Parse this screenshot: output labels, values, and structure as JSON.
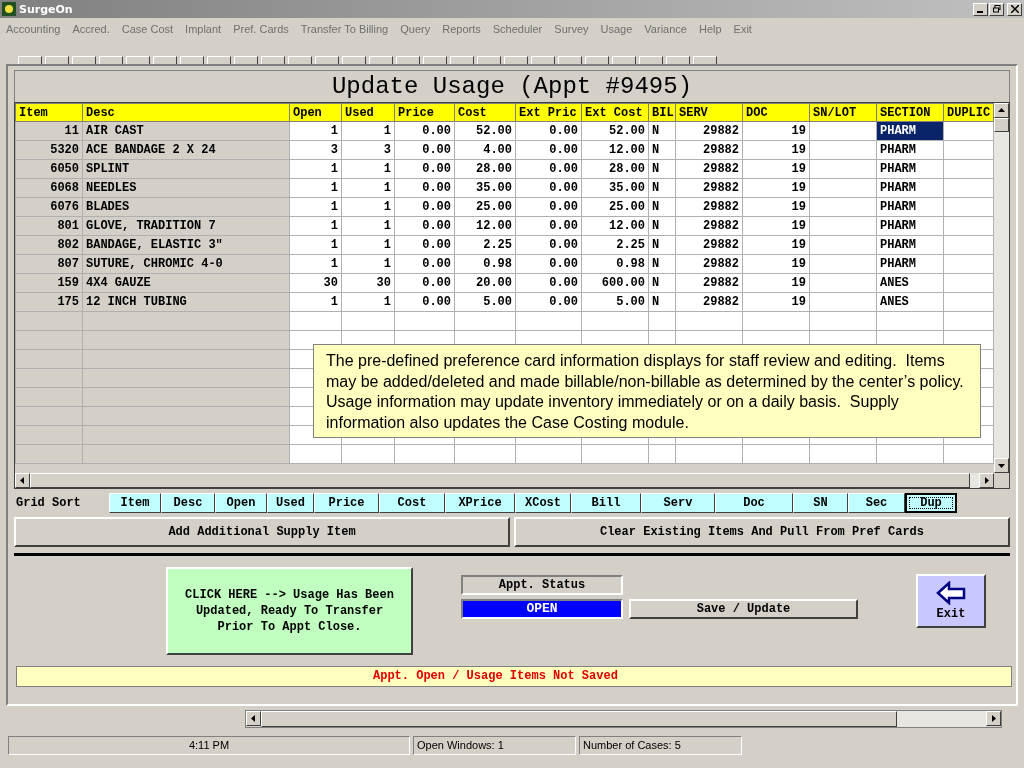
{
  "window": {
    "title": "SurgeOn"
  },
  "menu": [
    "Accounting",
    "Accred.",
    "Case Cost",
    "Implant",
    "Pref. Cards",
    "Transfer To Billing",
    "Query",
    "Reports",
    "Scheduler",
    "Survey",
    "Usage",
    "Variance",
    "Help",
    "Exit"
  ],
  "form": {
    "title": "Update Usage (Appt #9495)"
  },
  "grid": {
    "columns": [
      "Item",
      "Desc",
      "Open",
      "Used",
      "Price",
      "Cost",
      "Ext Pric",
      "Ext Cost",
      "BIL",
      "SERV",
      "DOC",
      "SN/LOT",
      "SECTION",
      "DUPLIC"
    ],
    "rows": [
      {
        "cells": [
          "11",
          "AIR CAST",
          "1",
          "1",
          "0.00",
          "52.00",
          "0.00",
          "52.00",
          "N",
          "29882",
          "19",
          "",
          "PHARM",
          ""
        ],
        "selected": true
      },
      {
        "cells": [
          "5320",
          "ACE BANDAGE 2 X 24",
          "3",
          "3",
          "0.00",
          "4.00",
          "0.00",
          "12.00",
          "N",
          "29882",
          "19",
          "",
          "PHARM",
          ""
        ],
        "selected": false
      },
      {
        "cells": [
          "6050",
          "SPLINT",
          "1",
          "1",
          "0.00",
          "28.00",
          "0.00",
          "28.00",
          "N",
          "29882",
          "19",
          "",
          "PHARM",
          ""
        ],
        "selected": false
      },
      {
        "cells": [
          "6068",
          "NEEDLES",
          "1",
          "1",
          "0.00",
          "35.00",
          "0.00",
          "35.00",
          "N",
          "29882",
          "19",
          "",
          "PHARM",
          ""
        ],
        "selected": false
      },
      {
        "cells": [
          "6076",
          "BLADES",
          "1",
          "1",
          "0.00",
          "25.00",
          "0.00",
          "25.00",
          "N",
          "29882",
          "19",
          "",
          "PHARM",
          ""
        ],
        "selected": false
      },
      {
        "cells": [
          "801",
          "GLOVE, TRADITION 7",
          "1",
          "1",
          "0.00",
          "12.00",
          "0.00",
          "12.00",
          "N",
          "29882",
          "19",
          "",
          "PHARM",
          ""
        ],
        "selected": false
      },
      {
        "cells": [
          "802",
          "BANDAGE, ELASTIC 3\"",
          "1",
          "1",
          "0.00",
          "2.25",
          "0.00",
          "2.25",
          "N",
          "29882",
          "19",
          "",
          "PHARM",
          ""
        ],
        "selected": false
      },
      {
        "cells": [
          "807",
          "SUTURE, CHROMIC 4-0",
          "1",
          "1",
          "0.00",
          "0.98",
          "0.00",
          "0.98",
          "N",
          "29882",
          "19",
          "",
          "PHARM",
          ""
        ],
        "selected": false
      },
      {
        "cells": [
          "159",
          "4X4 GAUZE",
          "30",
          "30",
          "0.00",
          "20.00",
          "0.00",
          "600.00",
          "N",
          "29882",
          "19",
          "",
          "ANES",
          ""
        ],
        "selected": false
      },
      {
        "cells": [
          "175",
          "12 INCH TUBING",
          "1",
          "1",
          "0.00",
          "5.00",
          "0.00",
          "5.00",
          "N",
          "29882",
          "19",
          "",
          "ANES",
          ""
        ],
        "selected": false
      }
    ]
  },
  "note": "The pre-defined preference card information displays for staff review and editing.  Items may be added/deleted and made billable/non-billable as determined by the center’s policy.  Usage information may update inventory immediately or on a daily basis.  Supply information also updates the Case Costing module.",
  "grid_sort": {
    "label": "Grid Sort",
    "buttons": [
      {
        "label": "Item",
        "selected": false
      },
      {
        "label": "Desc",
        "selected": false
      },
      {
        "label": "Open",
        "selected": false
      },
      {
        "label": "Used",
        "selected": false
      },
      {
        "label": "Price",
        "selected": false
      },
      {
        "label": "Cost",
        "selected": false
      },
      {
        "label": "XPrice",
        "selected": false
      },
      {
        "label": "XCost",
        "selected": false
      },
      {
        "label": "Bill",
        "selected": false
      },
      {
        "label": "Serv",
        "selected": false
      },
      {
        "label": "Doc",
        "selected": false
      },
      {
        "label": "SN",
        "selected": false
      },
      {
        "label": "Sec",
        "selected": false
      },
      {
        "label": "Dup",
        "selected": true
      }
    ]
  },
  "actions": [
    "Add Additional Supply Item",
    "Clear Existing Items And Pull From Pref Cards"
  ],
  "transfer_button": "CLICK HERE --> Usage Has Been Updated, Ready To Transfer Prior To Appt Close.",
  "appt_status": {
    "label": "Appt. Status",
    "value": "OPEN"
  },
  "save_button": "Save / Update",
  "exit_button": "Exit",
  "message": "Appt. Open / Usage Items Not Saved",
  "status_bar": [
    "4:11 PM",
    "Open Windows: 1",
    "Number of Cases: 5"
  ]
}
